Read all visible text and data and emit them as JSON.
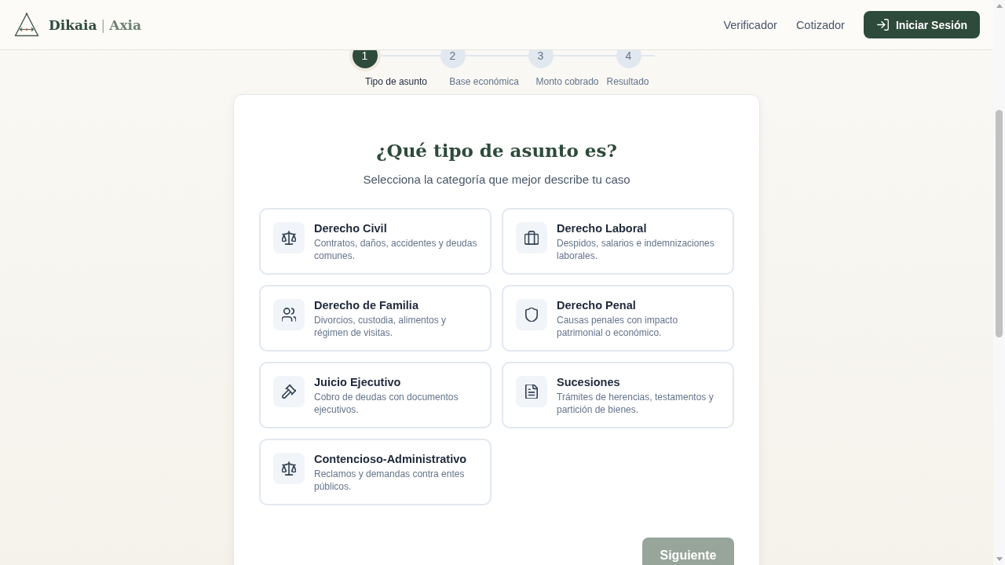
{
  "header": {
    "brand": {
      "name": "Dikaia",
      "separator": "|",
      "product": "Axia"
    },
    "nav": [
      "Verificador",
      "Cotizador"
    ],
    "login_button": {
      "label": "Iniciar Sesión"
    }
  },
  "stepper": {
    "steps": [
      {
        "number": "1",
        "label": "Tipo de asunto",
        "selected": true
      },
      {
        "number": "2",
        "label": "Base económica",
        "selected": false
      },
      {
        "number": "3",
        "label": "Monto cobrado",
        "selected": false
      },
      {
        "number": "4",
        "label": "Resultado",
        "selected": false
      }
    ]
  },
  "question": {
    "title": "¿Qué tipo de asunto es?",
    "subtitle": "Selecciona la categoría que mejor describe tu caso"
  },
  "options": [
    {
      "title": "Derecho Civil",
      "description": "Contratos, daños, accidentes y deudas comunes.",
      "selected": false
    },
    {
      "title": "Derecho Laboral",
      "description": "Despidos, salarios e indemnizaciones laborales.",
      "selected": false
    },
    {
      "title": "Derecho de Familia",
      "description": "Divorcios, custodia, alimentos y régimen de visitas.",
      "selected": false
    },
    {
      "title": "Derecho Penal",
      "description": "Causas penales con impacto patrimonial o económico.",
      "selected": false
    },
    {
      "title": "Juicio Ejecutivo",
      "description": "Cobro de deudas con documentos ejecutivos.",
      "selected": false
    },
    {
      "title": "Sucesiones",
      "description": "Trámites de herencias, testamentos y partición de bienes.",
      "selected": false
    },
    {
      "title": "Contencioso-Administrativo",
      "description": "Reclamos y demandas contra entes públicos.",
      "selected": false
    }
  ],
  "next_button": {
    "label": "Siguiente",
    "disabled": true
  }
}
